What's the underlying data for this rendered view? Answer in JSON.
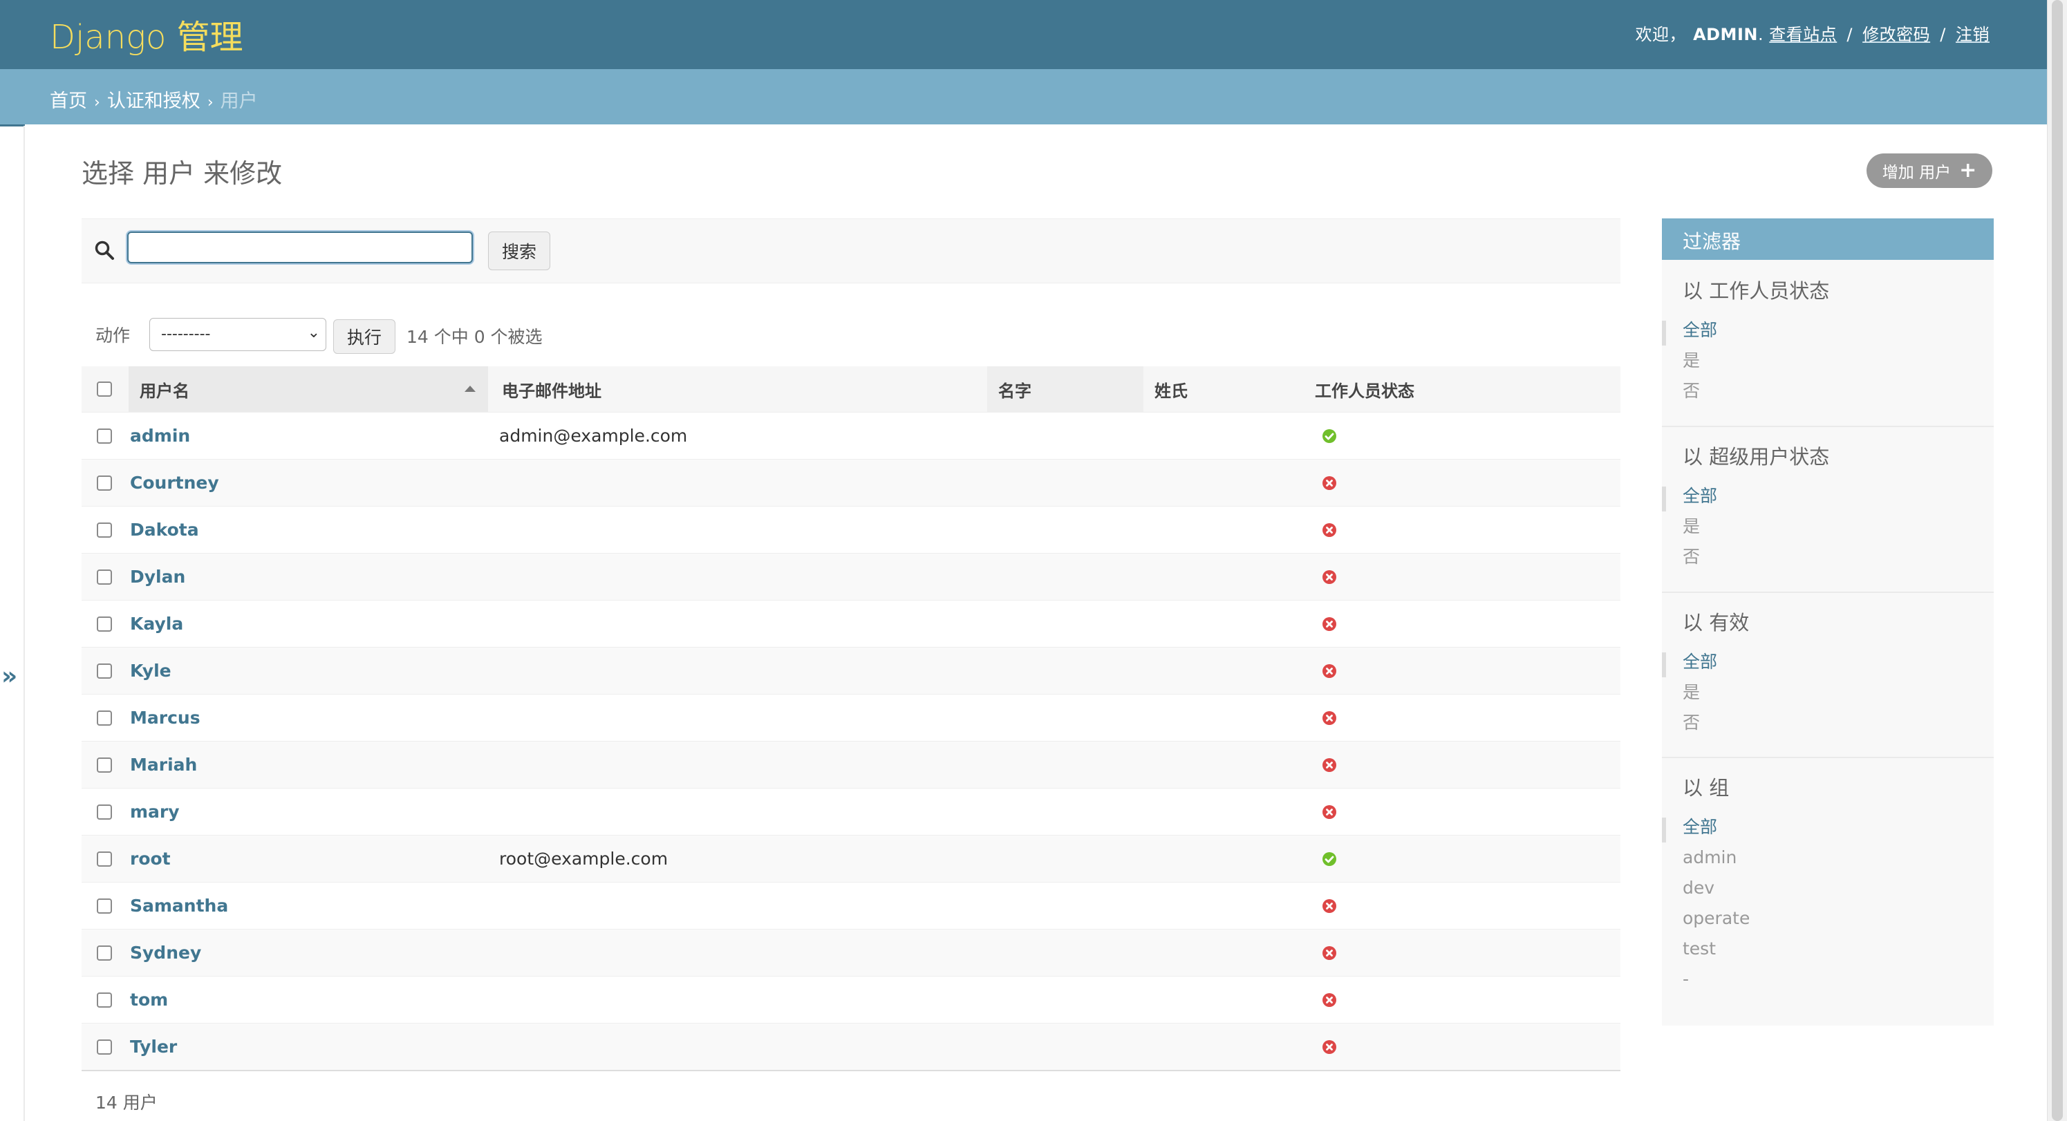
{
  "header": {
    "branding": "Django 管理",
    "welcome": "欢迎，",
    "username": "ADMIN",
    "username_suffix": ".",
    "links": [
      "查看站点",
      "修改密码",
      "注销"
    ],
    "separator": "/"
  },
  "breadcrumbs": {
    "items": [
      "首页",
      "认证和授权"
    ],
    "current": "用户",
    "separator": "›"
  },
  "nav_toggle": "»",
  "main": {
    "title": "选择 用户 来修改",
    "add_button_label": "增加 用户",
    "add_button_icon": "plus-icon"
  },
  "search": {
    "value": "",
    "submit_label": "搜索"
  },
  "actions": {
    "label": "动作",
    "selected_option": "---------",
    "go_label": "执行",
    "counter": "14 个中 0 个被选"
  },
  "table": {
    "columns": [
      "用户名",
      "电子邮件地址",
      "名字",
      "姓氏",
      "工作人员状态"
    ],
    "rows": [
      {
        "username": "admin",
        "email": "admin@example.com",
        "first_name": "",
        "last_name": "",
        "staff": true
      },
      {
        "username": "Courtney",
        "email": "",
        "first_name": "",
        "last_name": "",
        "staff": false
      },
      {
        "username": "Dakota",
        "email": "",
        "first_name": "",
        "last_name": "",
        "staff": false
      },
      {
        "username": "Dylan",
        "email": "",
        "first_name": "",
        "last_name": "",
        "staff": false
      },
      {
        "username": "Kayla",
        "email": "",
        "first_name": "",
        "last_name": "",
        "staff": false
      },
      {
        "username": "Kyle",
        "email": "",
        "first_name": "",
        "last_name": "",
        "staff": false
      },
      {
        "username": "Marcus",
        "email": "",
        "first_name": "",
        "last_name": "",
        "staff": false
      },
      {
        "username": "Mariah",
        "email": "",
        "first_name": "",
        "last_name": "",
        "staff": false
      },
      {
        "username": "mary",
        "email": "",
        "first_name": "",
        "last_name": "",
        "staff": false
      },
      {
        "username": "root",
        "email": "root@example.com",
        "first_name": "",
        "last_name": "",
        "staff": true
      },
      {
        "username": "Samantha",
        "email": "",
        "first_name": "",
        "last_name": "",
        "staff": false
      },
      {
        "username": "Sydney",
        "email": "",
        "first_name": "",
        "last_name": "",
        "staff": false
      },
      {
        "username": "tom",
        "email": "",
        "first_name": "",
        "last_name": "",
        "staff": false
      },
      {
        "username": "Tyler",
        "email": "",
        "first_name": "",
        "last_name": "",
        "staff": false
      }
    ]
  },
  "paginator": "14 用户",
  "filter": {
    "title": "过滤器",
    "groups": [
      {
        "title": "以 工作人员状态",
        "options": [
          "全部",
          "是",
          "否"
        ],
        "selected": 0
      },
      {
        "title": "以 超级用户状态",
        "options": [
          "全部",
          "是",
          "否"
        ],
        "selected": 0
      },
      {
        "title": "以 有效",
        "options": [
          "全部",
          "是",
          "否"
        ],
        "selected": 0
      },
      {
        "title": "以 组",
        "options": [
          "全部",
          "admin",
          "dev",
          "operate",
          "test",
          "-"
        ],
        "selected": 0
      }
    ]
  },
  "colors": {
    "header_bg": "#417690",
    "breadcrumbs_bg": "#79aec8",
    "branding": "#f5dd5d",
    "link": "#417690",
    "icon_yes": "#70bf2b",
    "icon_no": "#dd4646"
  }
}
